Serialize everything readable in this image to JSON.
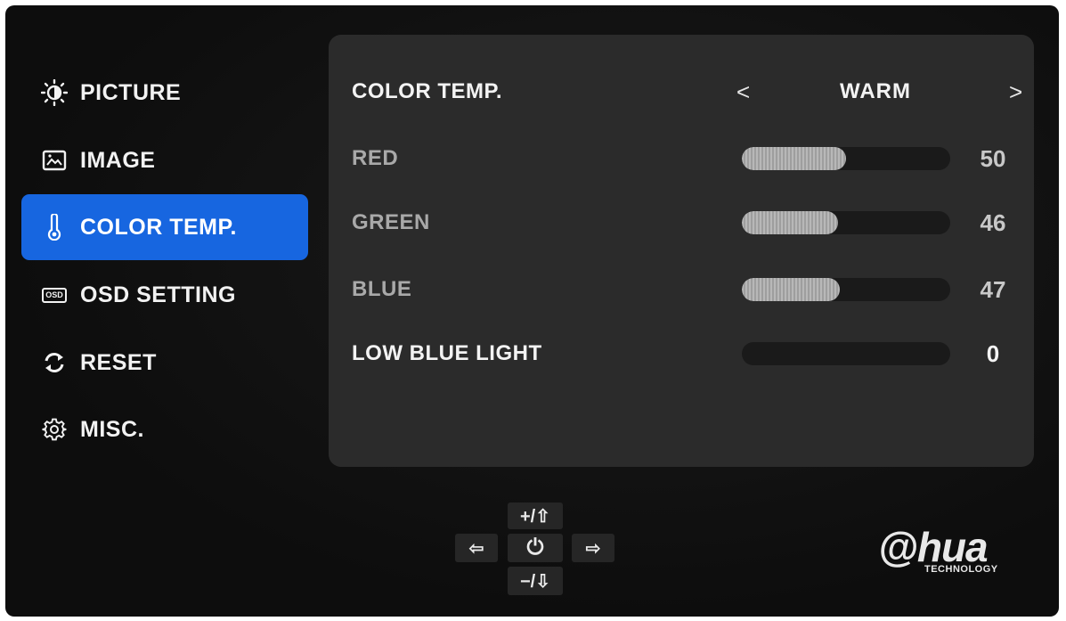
{
  "sidebar": {
    "items": [
      {
        "label": "PICTURE",
        "icon": "brightness-icon",
        "active": false
      },
      {
        "label": "IMAGE",
        "icon": "image-icon",
        "active": false
      },
      {
        "label": "COLOR TEMP.",
        "icon": "thermometer-icon",
        "active": true
      },
      {
        "label": "OSD SETTING",
        "icon": "osd-icon",
        "active": false
      },
      {
        "label": "RESET",
        "icon": "reset-icon",
        "active": false
      },
      {
        "label": "MISC.",
        "icon": "gear-icon",
        "active": false
      }
    ],
    "osd_icon_text": "OSD"
  },
  "panel": {
    "color_temp": {
      "label": "COLOR TEMP.",
      "value": "WARM",
      "prev": "<",
      "next": ">"
    },
    "sliders": [
      {
        "label": "RED",
        "value": 50,
        "display": "50"
      },
      {
        "label": "GREEN",
        "value": 46,
        "display": "46"
      },
      {
        "label": "BLUE",
        "value": 47,
        "display": "47"
      },
      {
        "label": "LOW BLUE LIGHT",
        "value": 0,
        "display": "0"
      }
    ]
  },
  "controls": {
    "up": "+/⇧",
    "down": "−/⇩",
    "left": "⇦",
    "power": "⏻",
    "right": "⇨"
  },
  "logo": {
    "main": "@hua",
    "sub": "TECHNOLOGY"
  },
  "colors": {
    "active": "#1766e0",
    "panel": "#2b2b2b",
    "background": "#101010"
  }
}
